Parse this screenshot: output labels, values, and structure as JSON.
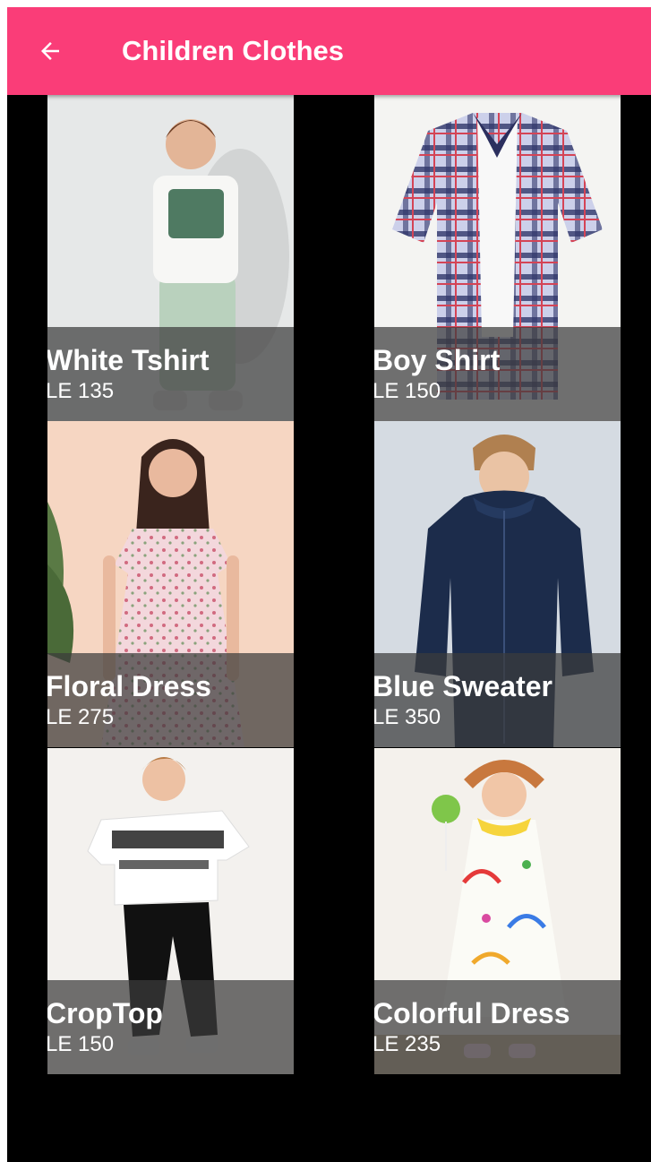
{
  "appbar": {
    "title": "Children Clothes",
    "back_icon": "arrow-left-icon",
    "background_color": "#fa3d78"
  },
  "products": [
    {
      "name": "White Tshirt",
      "price": "LE 135"
    },
    {
      "name": "Boy Shirt",
      "price": "LE 150"
    },
    {
      "name": "Floral Dress",
      "price": "LE 275"
    },
    {
      "name": "Blue Sweater",
      "price": "LE 350"
    },
    {
      "name": "CropTop",
      "price": "LE 150"
    },
    {
      "name": "Colorful Dress",
      "price": "LE 235"
    }
  ]
}
